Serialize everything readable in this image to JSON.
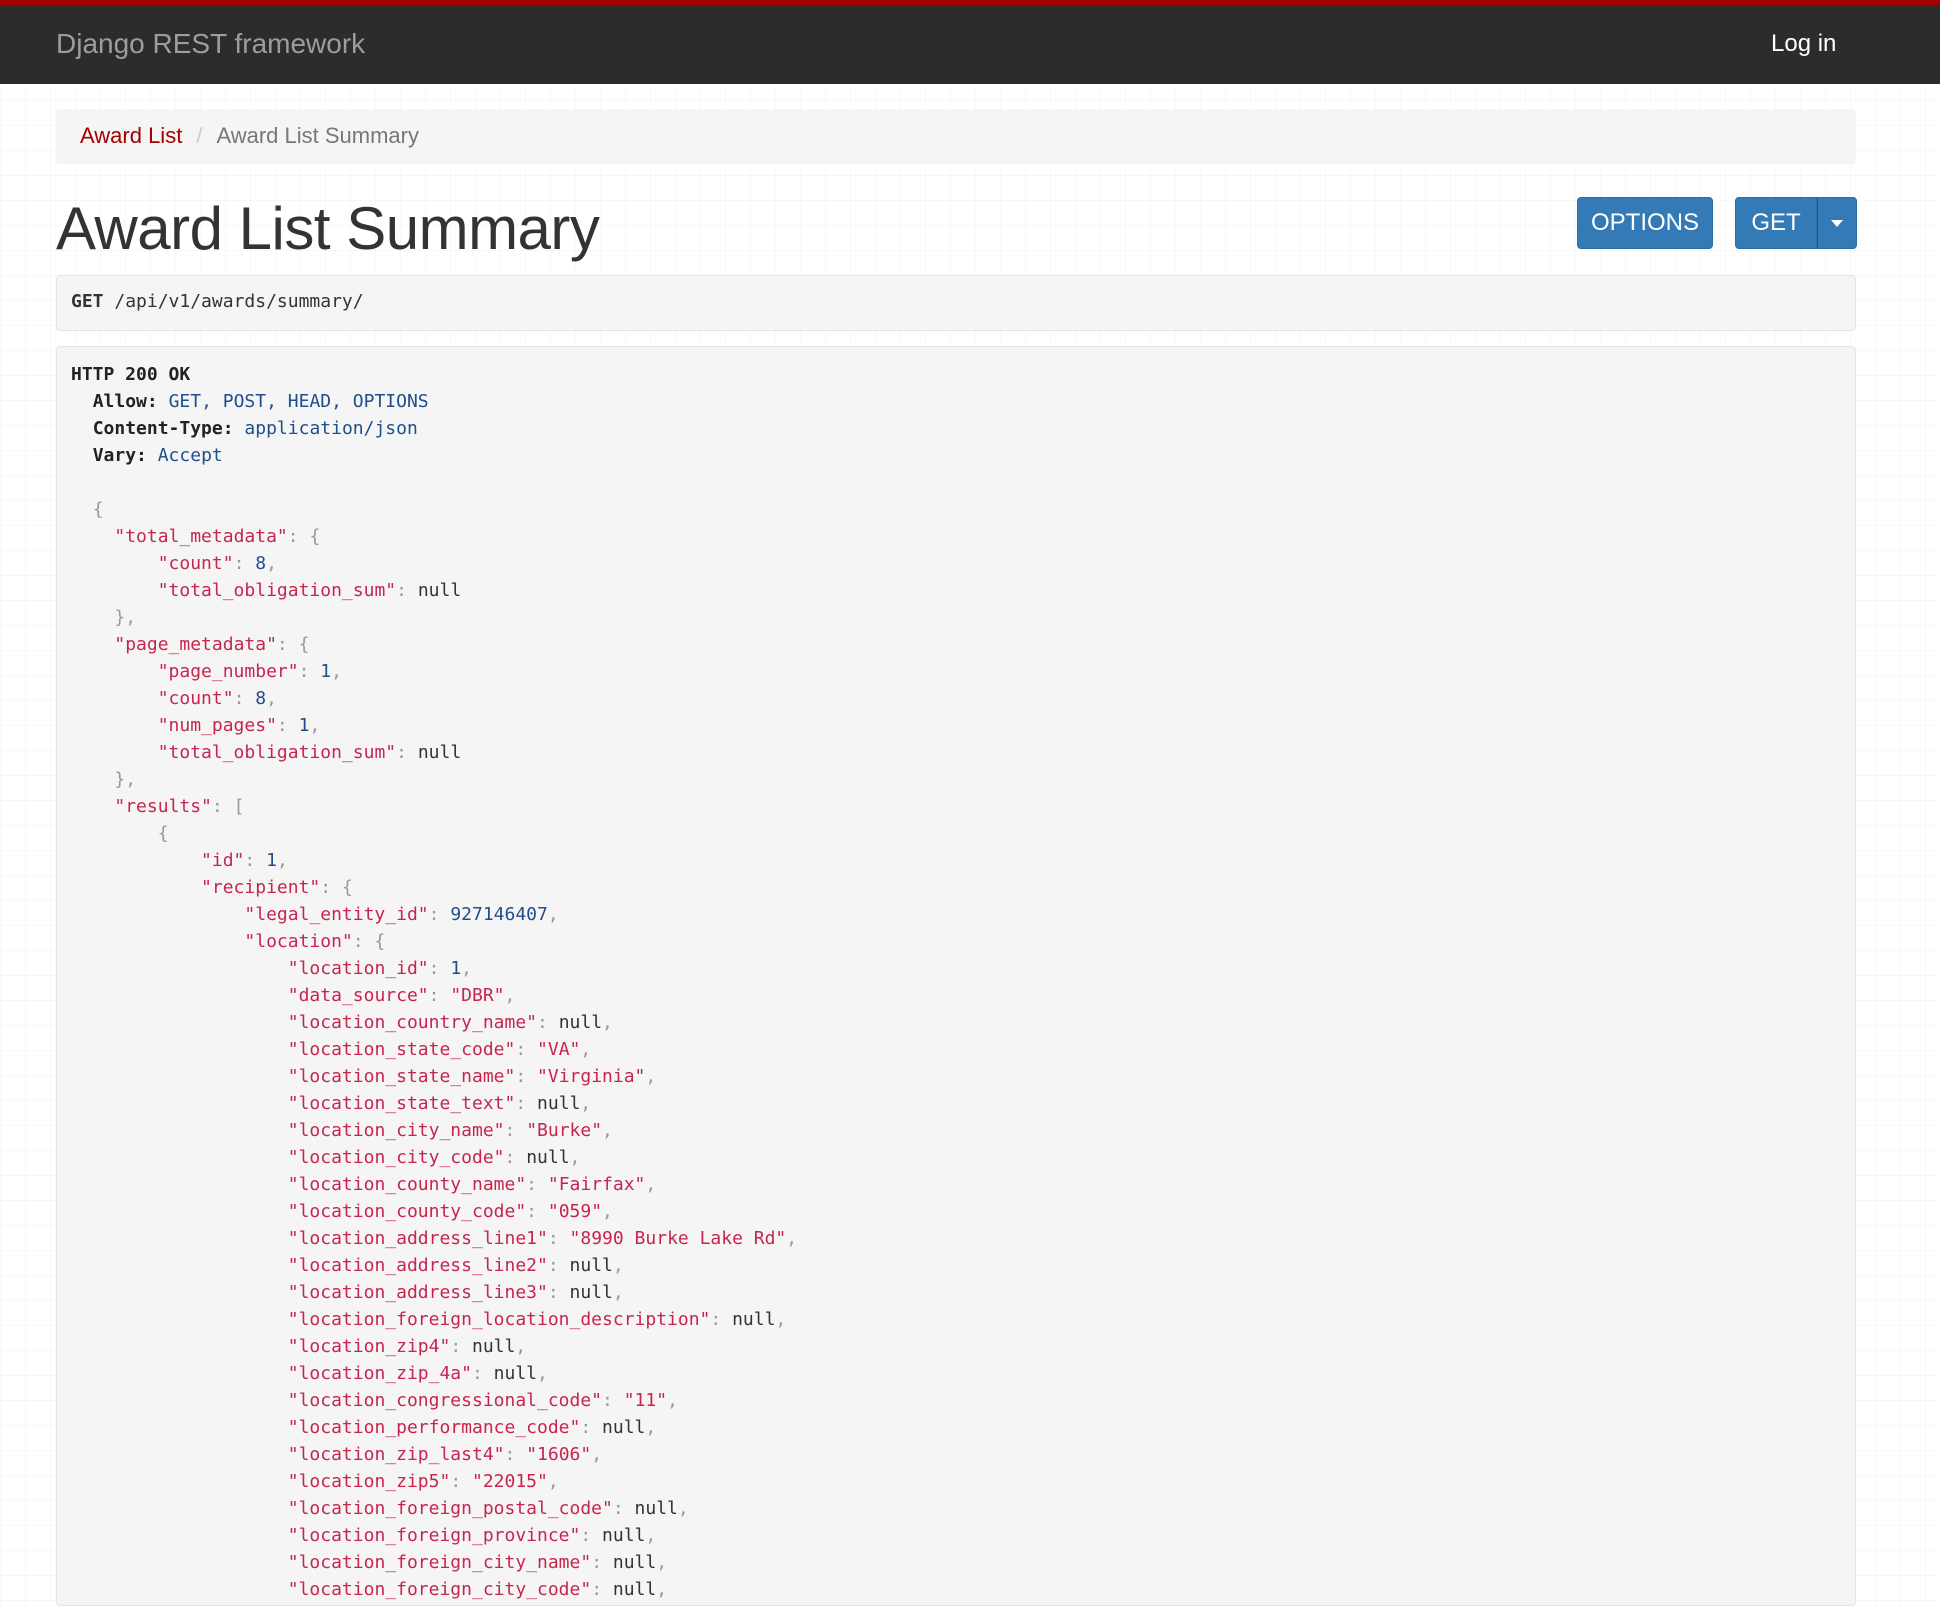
{
  "navbar": {
    "brand": "Django REST framework",
    "login": "Log in"
  },
  "breadcrumb": {
    "items": [
      "Award List",
      "Award List Summary"
    ]
  },
  "page": {
    "title": "Award List Summary"
  },
  "buttons": {
    "options": "OPTIONS",
    "get": "GET"
  },
  "request": {
    "method": "GET",
    "path": "/api/v1/awards/summary/"
  },
  "response": {
    "status": "HTTP 200 OK",
    "headers": [
      {
        "name": "Allow:",
        "value": "GET, POST, HEAD, OPTIONS"
      },
      {
        "name": "Content-Type:",
        "value": "application/json"
      },
      {
        "name": "Vary:",
        "value": "Accept"
      }
    ],
    "body_lines": [
      [
        0,
        "{",
        null,
        null
      ],
      [
        1,
        "\"total_metadata\"",
        "{",
        null
      ],
      [
        2,
        "\"count\"",
        "8",
        ","
      ],
      [
        2,
        "\"total_obligation_sum\"",
        "null",
        ""
      ],
      [
        1,
        "}",
        null,
        ","
      ],
      [
        1,
        "\"page_metadata\"",
        "{",
        null
      ],
      [
        2,
        "\"page_number\"",
        "1",
        ","
      ],
      [
        2,
        "\"count\"",
        "8",
        ","
      ],
      [
        2,
        "\"num_pages\"",
        "1",
        ","
      ],
      [
        2,
        "\"total_obligation_sum\"",
        "null",
        ""
      ],
      [
        1,
        "}",
        null,
        ","
      ],
      [
        1,
        "\"results\"",
        "[",
        null
      ],
      [
        2,
        "{",
        null,
        null
      ],
      [
        3,
        "\"id\"",
        "1",
        ","
      ],
      [
        3,
        "\"recipient\"",
        "{",
        null
      ],
      [
        4,
        "\"legal_entity_id\"",
        "927146407",
        ","
      ],
      [
        4,
        "\"location\"",
        "{",
        null
      ],
      [
        5,
        "\"location_id\"",
        "1",
        ","
      ],
      [
        5,
        "\"data_source\"",
        "\"DBR\"",
        ","
      ],
      [
        5,
        "\"location_country_name\"",
        "null",
        ","
      ],
      [
        5,
        "\"location_state_code\"",
        "\"VA\"",
        ","
      ],
      [
        5,
        "\"location_state_name\"",
        "\"Virginia\"",
        ","
      ],
      [
        5,
        "\"location_state_text\"",
        "null",
        ","
      ],
      [
        5,
        "\"location_city_name\"",
        "\"Burke\"",
        ","
      ],
      [
        5,
        "\"location_city_code\"",
        "null",
        ","
      ],
      [
        5,
        "\"location_county_name\"",
        "\"Fairfax\"",
        ","
      ],
      [
        5,
        "\"location_county_code\"",
        "\"059\"",
        ","
      ],
      [
        5,
        "\"location_address_line1\"",
        "\"8990 Burke Lake Rd\"",
        ","
      ],
      [
        5,
        "\"location_address_line2\"",
        "null",
        ","
      ],
      [
        5,
        "\"location_address_line3\"",
        "null",
        ","
      ],
      [
        5,
        "\"location_foreign_location_description\"",
        "null",
        ","
      ],
      [
        5,
        "\"location_zip4\"",
        "null",
        ","
      ],
      [
        5,
        "\"location_zip_4a\"",
        "null",
        ","
      ],
      [
        5,
        "\"location_congressional_code\"",
        "\"11\"",
        ","
      ],
      [
        5,
        "\"location_performance_code\"",
        "null",
        ","
      ],
      [
        5,
        "\"location_zip_last4\"",
        "\"1606\"",
        ","
      ],
      [
        5,
        "\"location_zip5\"",
        "\"22015\"",
        ","
      ],
      [
        5,
        "\"location_foreign_postal_code\"",
        "null",
        ","
      ],
      [
        5,
        "\"location_foreign_province\"",
        "null",
        ","
      ],
      [
        5,
        "\"location_foreign_city_name\"",
        "null",
        ","
      ],
      [
        5,
        "\"location_foreign_city_code\"",
        "null",
        ","
      ]
    ]
  }
}
